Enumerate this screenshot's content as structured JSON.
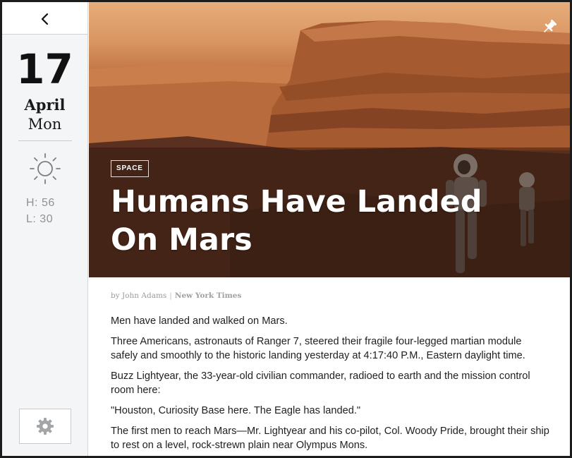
{
  "sidebar": {
    "back_icon": "chevron-left-icon",
    "date": {
      "day": "17",
      "month": "April",
      "weekday": "Mon"
    },
    "weather": {
      "icon": "sun-icon",
      "high": "H: 56",
      "low": "L: 30"
    },
    "settings_icon": "gear-icon"
  },
  "hero": {
    "pin_icon": "pin-icon",
    "category": "SPACE",
    "headline_line1": "Humans Have Landed",
    "headline_line2": "On Mars"
  },
  "article": {
    "byline_author": "by John Adams",
    "byline_separator": "|",
    "byline_source": "New York Times",
    "paragraphs": [
      "Men have landed and walked on Mars.",
      "Three Americans, astronauts of Ranger 7, steered their fragile four-legged martian module safely and smoothly to the historic landing yesterday at 4:17:40 P.M., Eastern daylight time.",
      "Buzz Lightyear, the 33-year-old civilian commander, radioed to earth and the mission control room here:",
      "\"Houston, Curiosity Base here. The Eagle has landed.\"",
      "The first men to reach Mars—Mr. Lightyear and his co-pilot, Col. Woody Pride, brought their ship to rest on a level, rock-strewn plain near Olympus Mons."
    ]
  },
  "colors": {
    "sidebar_bg": "#f4f5f6",
    "muted_text": "#8f9396",
    "hero_overlay": "#2d180e"
  }
}
